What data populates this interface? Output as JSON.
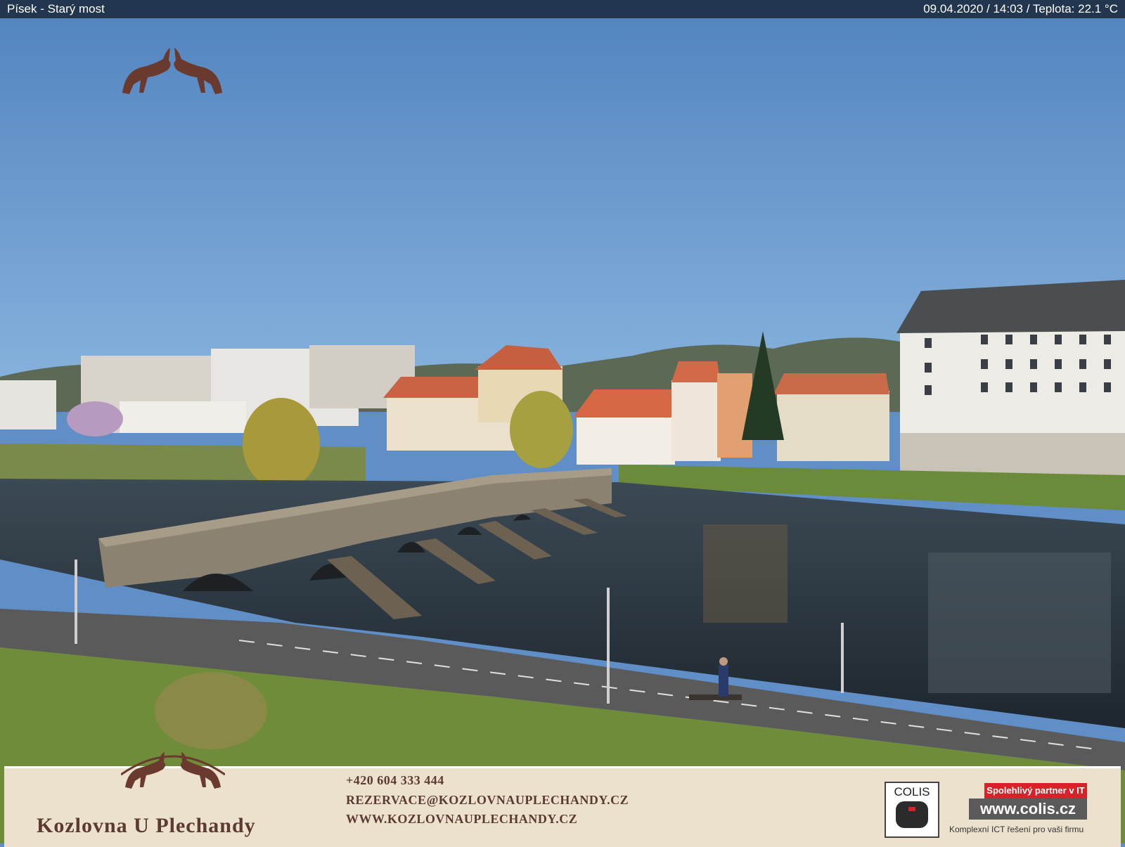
{
  "overlay": {
    "location": "Písek - Starý most",
    "status": "09.04.2020 / 14:03 / Teplota: 22.1 °C"
  },
  "footer": {
    "brand": "Kozlovna U Plechandy",
    "phone": "+420 604 333 444",
    "email": "REZERVACE@KOZLOVNAUPLECHANDY.CZ",
    "web": "WWW.KOZLOVNAUPLECHANDY.CZ"
  },
  "sponsor": {
    "logo_text": "COLIS",
    "badge": "Spolehlivý partner v IT",
    "url": "www.colis.cz",
    "tagline": "Komplexní ICT řešení pro vaši firmu"
  },
  "colors": {
    "sky": "#5f8fc6",
    "bar": "#22364f",
    "brand_brown": "#5b3a2f",
    "sponsor_red": "#d6232a"
  }
}
